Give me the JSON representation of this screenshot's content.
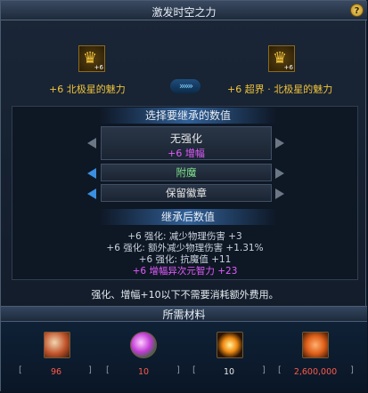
{
  "window": {
    "title": "激发时空之力",
    "help_label": "?"
  },
  "items": {
    "source": {
      "icon": "golden-helmet-icon",
      "level": "+6",
      "name": "+6 北极星的魅力"
    },
    "target": {
      "icon": "golden-helmet-icon",
      "level": "+6",
      "name": "+6 超界 · 北极星的魅力"
    },
    "arrow_label": "»»»"
  },
  "select_section": {
    "header": "选择要继承的数值",
    "options": [
      {
        "line1": "无强化",
        "line2": "+6 增幅",
        "line1_color": "#e8e8e8",
        "line2_color": "#e35cff"
      },
      {
        "line1": "附魔",
        "line2": "",
        "line1_color": "#7fe08a",
        "line2_color": ""
      },
      {
        "line1": "保留徽章",
        "line2": "",
        "line1_color": "#e8e8e8",
        "line2_color": ""
      }
    ]
  },
  "result_section": {
    "header": "继承后数值",
    "lines": [
      {
        "text": "+6 强化: 减少物理伤害 +3",
        "color": "#c9d3de"
      },
      {
        "text": "+6 强化: 额外减少物理伤害 +1.31%",
        "color": "#c9d3de"
      },
      {
        "text": "+6 强化: 抗魔值 +11",
        "color": "#c9d3de"
      },
      {
        "text": "+6 增幅异次元智力 +23",
        "color": "#e35cff"
      }
    ]
  },
  "note": "强化、增幅+10以下不需要消耗额外费用。",
  "materials": {
    "header": "所需材料",
    "items": [
      {
        "icon": "crystal-shard-icon",
        "quantity": "96",
        "qty_color": "#ff5a4a"
      },
      {
        "icon": "magic-orb-icon",
        "quantity": "10",
        "qty_color": "#ff5a4a"
      },
      {
        "icon": "time-rune-icon",
        "quantity": "10",
        "qty_color": "#e8e8e8"
      },
      {
        "icon": "gold-coins-icon",
        "quantity": "2,600,000",
        "qty_color": "#ff5a4a"
      }
    ]
  }
}
